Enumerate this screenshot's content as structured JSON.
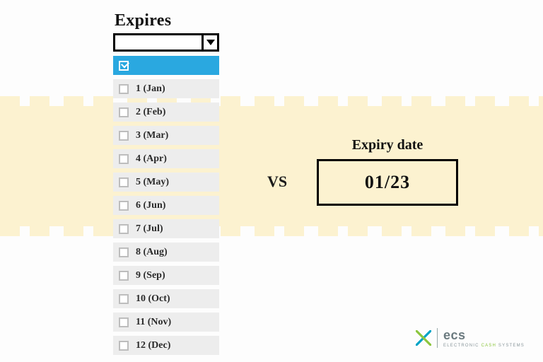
{
  "expires": {
    "title": "Expires",
    "options": [
      "1 (Jan)",
      "2 (Feb)",
      "3 (Mar)",
      "4 (Apr)",
      "5 (May)",
      "6 (Jun)",
      "7  (Jul)",
      "8 (Aug)",
      "9 (Sep)",
      "10 (Oct)",
      "11 (Nov)",
      "12 (Dec)"
    ]
  },
  "vs_label": "VS",
  "expiry": {
    "title": "Expiry date",
    "value": "01/23"
  },
  "logo": {
    "brand": "ecs",
    "sub_pre": "ELECTRONIC ",
    "sub_accent": "CASH",
    "sub_post": " SYSTEMS"
  }
}
